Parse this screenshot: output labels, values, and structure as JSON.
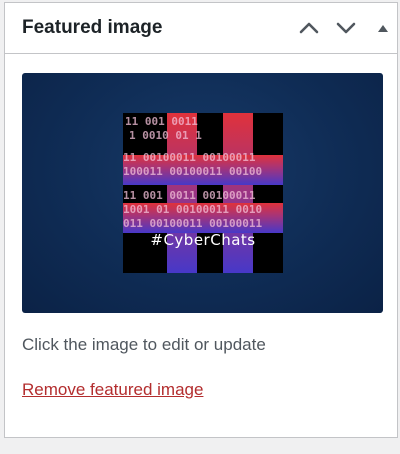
{
  "panel": {
    "title": "Featured image",
    "controls": {
      "move_up": "chevron-up-icon",
      "move_down": "chevron-down-icon",
      "toggle": "triangle-up-icon"
    }
  },
  "featured_image": {
    "thumbnail_text": "#CyberChats",
    "binary_rows": [
      "11 001 0011",
      "1 0010 01 1",
      "11 00100011 00100011",
      "100011 00100011 00100",
      "11 001 0011 00100011",
      "1001 01 00100011 0010",
      "011 00100011 00100011"
    ]
  },
  "help_text": "Click the image to edit or update",
  "remove_link": "Remove featured image",
  "colors": {
    "link": "#b32d2e",
    "frame_bg": "#0f2c55",
    "hashtag_top": "#d9333b",
    "hashtag_bottom": "#4a3bc4"
  }
}
